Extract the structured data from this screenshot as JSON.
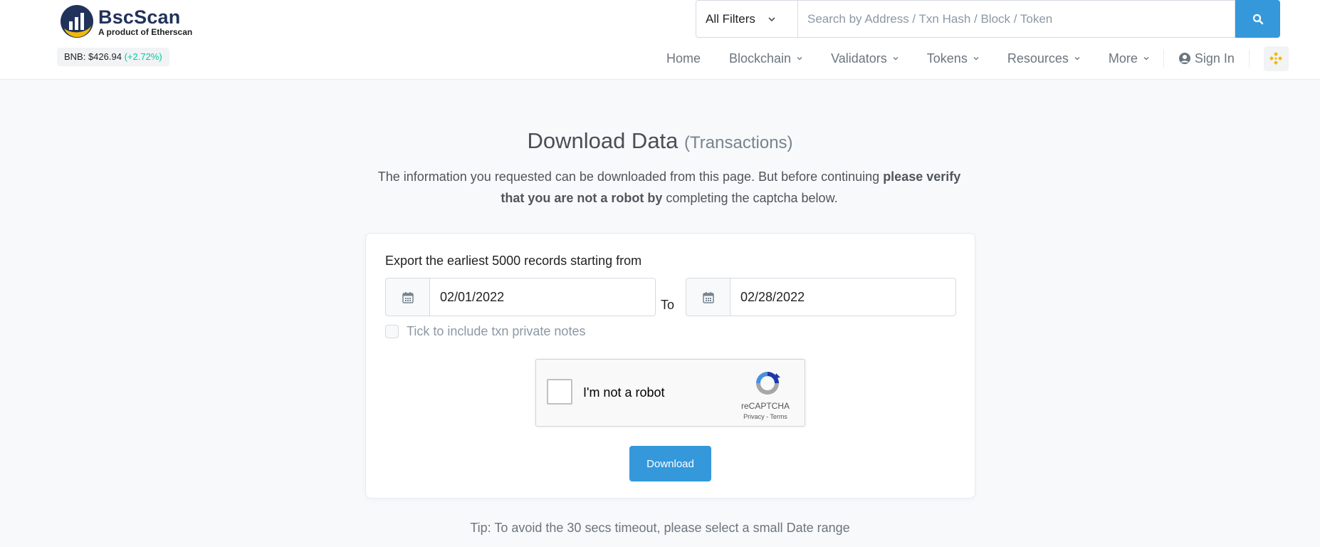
{
  "header": {
    "logo": {
      "name": "BscScan",
      "tagline": "A product of Etherscan"
    },
    "price": {
      "label": "BNB: $426.94",
      "change": "(+2.72%)"
    },
    "search": {
      "filter": "All Filters",
      "placeholder": "Search by Address / Txn Hash / Block / Token"
    },
    "nav": {
      "home": "Home",
      "blockchain": "Blockchain",
      "validators": "Validators",
      "tokens": "Tokens",
      "resources": "Resources",
      "more": "More",
      "signin": "Sign In"
    }
  },
  "main": {
    "title": "Download Data",
    "title_sub": "(Transactions)",
    "desc_part1": "The information you requested can be downloaded from this page. But before continuing ",
    "desc_bold": "please verify that you are not a robot by",
    "desc_part2": " completing the captcha below.",
    "card": {
      "export_label": "Export the earliest 5000 records starting from",
      "from_date": "02/01/2022",
      "to_label": "To",
      "to_date": "02/28/2022",
      "notes_label": "Tick to include txn private notes",
      "recaptcha": {
        "label": "I'm not a robot",
        "brand": "reCAPTCHA",
        "links": "Privacy - Terms"
      },
      "download_label": "Download"
    },
    "tip": "Tip: To avoid the 30 secs timeout, please select a small Date range"
  },
  "colors": {
    "accent": "#3498db",
    "positive": "#00c9a7",
    "brand_dark": "#21325b",
    "brand_yellow": "#f0b90b"
  },
  "icons": [
    "bscscan-logo-icon",
    "chevron-down-icon",
    "search-icon",
    "user-circle-icon",
    "bnb-icon",
    "calendar-icon",
    "recaptcha-icon"
  ]
}
